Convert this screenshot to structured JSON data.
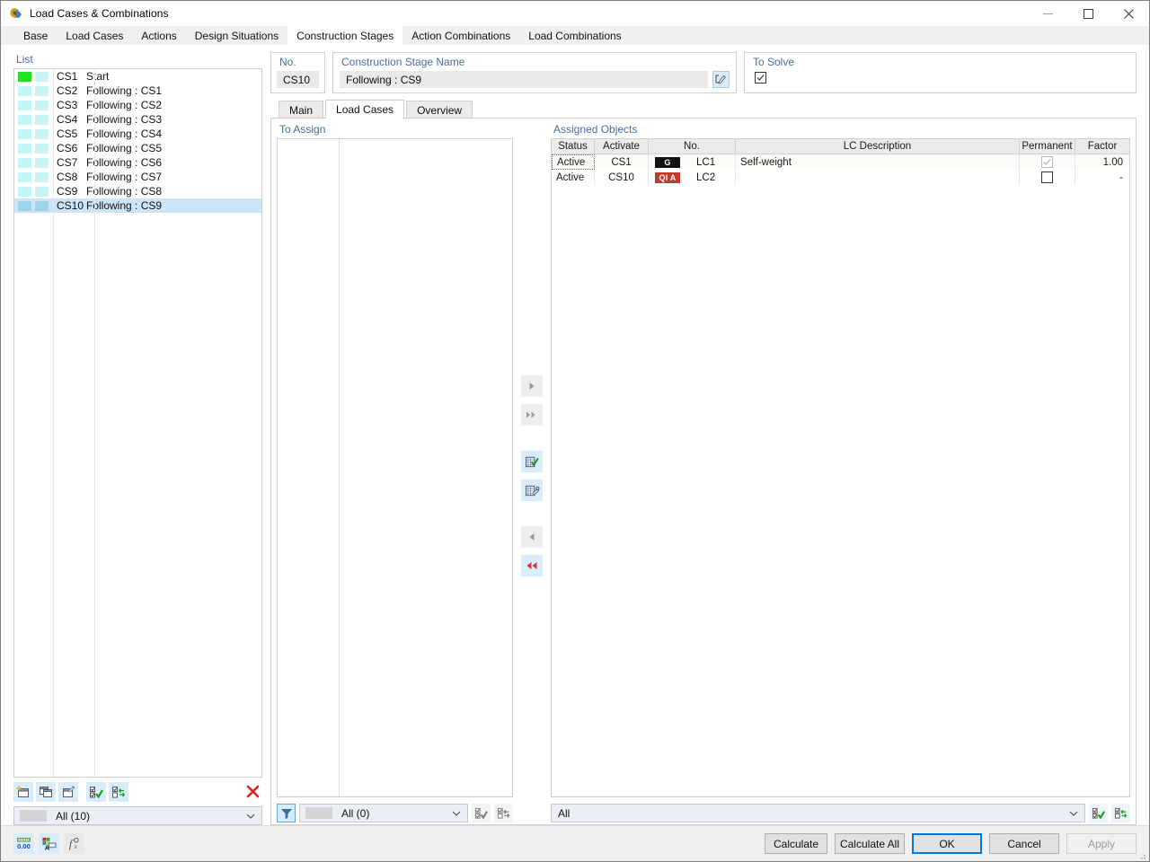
{
  "window": {
    "title": "Load Cases & Combinations",
    "icon": "app-icon",
    "minimize": "−",
    "maximize": "□",
    "close": "✕"
  },
  "tabs": [
    {
      "label": "Base",
      "active": false
    },
    {
      "label": "Load Cases",
      "active": false
    },
    {
      "label": "Actions",
      "active": false
    },
    {
      "label": "Design Situations",
      "active": false
    },
    {
      "label": "Construction Stages",
      "active": true
    },
    {
      "label": "Action Combinations",
      "active": false
    },
    {
      "label": "Load Combinations",
      "active": false
    }
  ],
  "list_panel": {
    "label": "List",
    "rows": [
      {
        "id": "CS1",
        "name": "Start",
        "color1": "#22e022",
        "color2": "#c6f5f5",
        "selected": false
      },
      {
        "id": "CS2",
        "name": "Following : CS1",
        "color1": "#c6f5f5",
        "color2": "#c6f5f5",
        "selected": false
      },
      {
        "id": "CS3",
        "name": "Following : CS2",
        "color1": "#c6f5f5",
        "color2": "#c6f5f5",
        "selected": false
      },
      {
        "id": "CS4",
        "name": "Following : CS3",
        "color1": "#c6f5f5",
        "color2": "#c6f5f5",
        "selected": false
      },
      {
        "id": "CS5",
        "name": "Following : CS4",
        "color1": "#c6f5f5",
        "color2": "#c6f5f5",
        "selected": false
      },
      {
        "id": "CS6",
        "name": "Following : CS5",
        "color1": "#c6f5f5",
        "color2": "#c6f5f5",
        "selected": false
      },
      {
        "id": "CS7",
        "name": "Following : CS6",
        "color1": "#c6f5f5",
        "color2": "#c6f5f5",
        "selected": false
      },
      {
        "id": "CS8",
        "name": "Following : CS7",
        "color1": "#c6f5f5",
        "color2": "#c6f5f5",
        "selected": false
      },
      {
        "id": "CS9",
        "name": "Following : CS8",
        "color1": "#c6f5f5",
        "color2": "#c6f5f5",
        "selected": false
      },
      {
        "id": "CS10",
        "name": "Following : CS9",
        "color1": "#9fd4e8",
        "color2": "#9fd4e8",
        "selected": true
      }
    ],
    "toolbar": [
      {
        "name": "new-item-button",
        "icon": "new-window-icon"
      },
      {
        "name": "copy-item-button",
        "icon": "copy-window-icon"
      },
      {
        "name": "edit-item-button",
        "icon": "edit-window-icon"
      },
      {
        "name": "select-all-button",
        "icon": "check-all-icon"
      },
      {
        "name": "invert-selection-button",
        "icon": "swap-check-icon"
      }
    ],
    "delete_button": "delete-icon",
    "filter": {
      "value": "All (10)",
      "swatch": "#d4d4d4"
    }
  },
  "header": {
    "no_label": "No.",
    "no_value": "CS10",
    "name_label": "Construction Stage Name",
    "name_value": "Following : CS9",
    "name_edit_icon": "edit-pencil-icon",
    "solve_label": "To Solve",
    "solve_checked": true
  },
  "inner_tabs": [
    {
      "label": "Main",
      "active": false
    },
    {
      "label": "Load Cases",
      "active": true
    },
    {
      "label": "Overview",
      "active": false
    }
  ],
  "to_assign": {
    "label": "To Assign",
    "rows": [],
    "filter_button_icon": "funnel-icon",
    "combo": {
      "value": "All (0)",
      "swatch": "#d4d4d4"
    },
    "buttons": [
      {
        "name": "select-all-to-assign-button",
        "icon": "check-all-icon"
      },
      {
        "name": "invert-to-assign-button",
        "icon": "swap-check-icon"
      }
    ]
  },
  "transfer_buttons": [
    {
      "name": "assign-selected-button",
      "icon": "arrow-right-icon",
      "style": "grey"
    },
    {
      "name": "assign-all-button",
      "icon": "double-arrow-right-icon",
      "style": "grey"
    },
    {
      "name": "new-load-case-button",
      "icon": "grid-check-icon",
      "style": "blue"
    },
    {
      "name": "edit-load-case-button",
      "icon": "grid-wrench-icon",
      "style": "blue"
    },
    {
      "name": "unassign-selected-button",
      "icon": "arrow-left-icon",
      "style": "grey"
    },
    {
      "name": "unassign-all-button",
      "icon": "double-arrow-left-red-icon",
      "style": "blue"
    }
  ],
  "assigned": {
    "label": "Assigned Objects",
    "columns": [
      "Status",
      "Activate",
      "No.",
      "LC Description",
      "Permanent",
      "Factor"
    ],
    "rows": [
      {
        "status": "Active",
        "activate": "CS1",
        "badge": "G",
        "badge_color": "#111111",
        "no": "LC1",
        "description": "Self-weight",
        "permanent": true,
        "permanent_disabled": true,
        "factor": "1.00"
      },
      {
        "status": "Active",
        "activate": "CS10",
        "badge": "QI A",
        "badge_color": "#c0392b",
        "no": "LC2",
        "description": "",
        "permanent": false,
        "permanent_disabled": false,
        "factor": "-"
      }
    ],
    "combo": {
      "value": "All"
    },
    "buttons": [
      {
        "name": "select-all-assigned-button",
        "icon": "check-all-icon"
      },
      {
        "name": "invert-assigned-button",
        "icon": "swap-check-icon"
      }
    ]
  },
  "footer": {
    "left_buttons": [
      {
        "name": "decimal-places-button",
        "icon": "number-format-icon",
        "label": "0.00"
      },
      {
        "name": "units-button",
        "icon": "units-icon"
      },
      {
        "name": "formula-button",
        "icon": "function-icon"
      }
    ],
    "calculate": "Calculate",
    "calculate_all": "Calculate All",
    "ok": "OK",
    "cancel": "Cancel",
    "apply": "Apply"
  }
}
